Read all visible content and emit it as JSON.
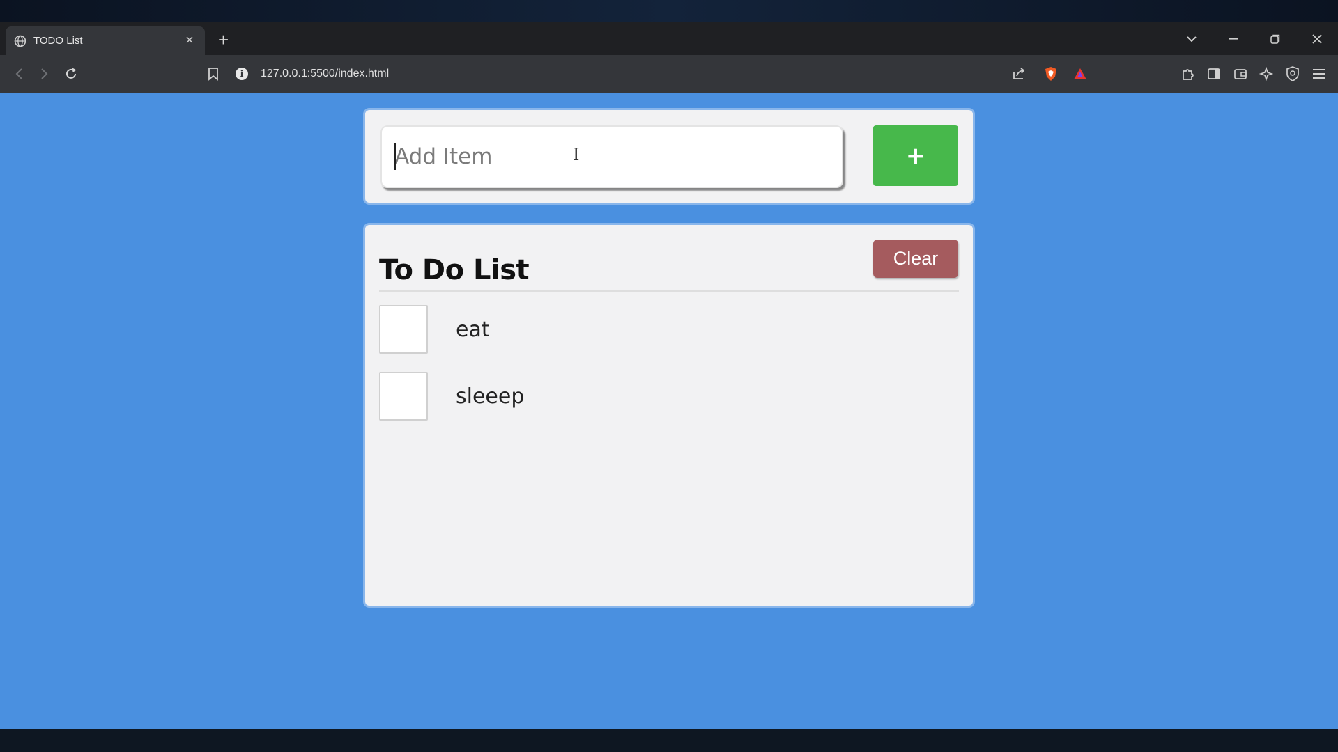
{
  "browser": {
    "tab_title": "TODO List",
    "new_tab_symbol": "+",
    "url": "127.0.0.1:5500/index.html"
  },
  "icons": [
    "globe-icon",
    "tab-close-icon",
    "new-tab-icon",
    "tab-list-icon",
    "minimize-icon",
    "restore-icon",
    "window-close-icon",
    "back-icon",
    "forward-icon",
    "reload-icon",
    "bookmark-icon",
    "site-info-icon",
    "share-icon",
    "brave-shield-icon",
    "brave-rewards-icon",
    "extensions-icon",
    "sidebar-icon",
    "wallet-icon",
    "leo-icon",
    "vpn-icon",
    "menu-icon",
    "text-cursor-icon"
  ],
  "colors": {
    "page_background": "#4a90e0",
    "card_background": "#f2f2f3",
    "add_button": "#47b84b",
    "clear_button": "#a55b5e"
  },
  "add_form": {
    "placeholder": "Add Item",
    "value": "",
    "add_label": "+"
  },
  "list": {
    "title": "To Do List",
    "clear_label": "Clear",
    "items": [
      {
        "label": "eat",
        "checked": false
      },
      {
        "label": "sleeep",
        "checked": false
      }
    ]
  }
}
